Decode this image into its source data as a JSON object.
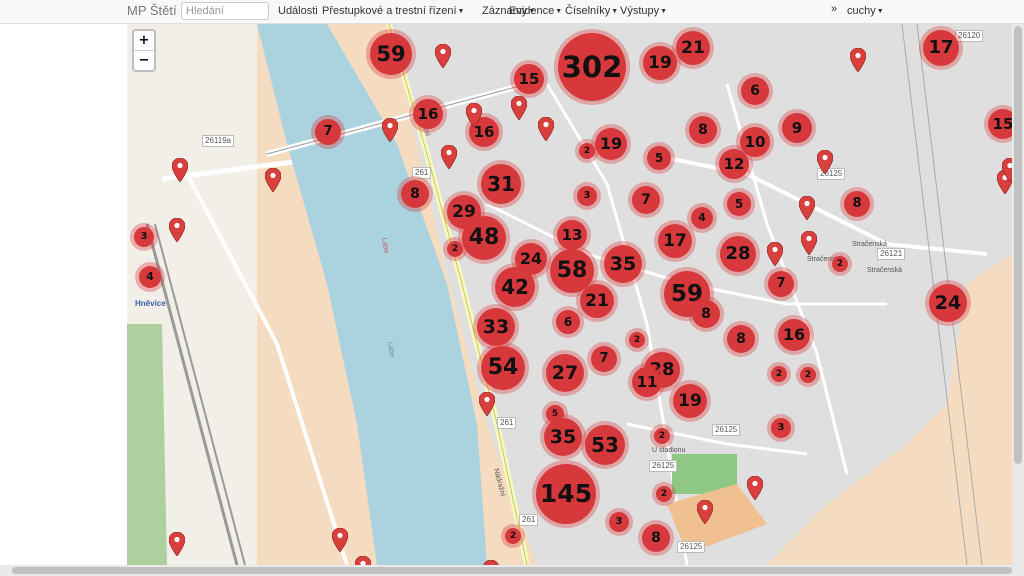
{
  "navbar": {
    "brand": "MP Štětí",
    "search_placeholder": "Hledání",
    "items": [
      {
        "label": "Události",
        "caret": false
      },
      {
        "label": "Přestupkové a trestní řízení",
        "caret": true
      },
      {
        "label": "Záznamy",
        "caret": true
      },
      {
        "label": "Evidence",
        "caret": true
      },
      {
        "label": "Číselníky",
        "caret": true
      },
      {
        "label": "Výstupy",
        "caret": true
      }
    ],
    "collapse_glyph": "»",
    "user": "cuchy"
  },
  "map": {
    "zoom_in": "+",
    "zoom_out": "−",
    "colors": {
      "cluster": "#d6383c",
      "pin": "#d9403d",
      "river": "#aad3df",
      "land": "#eee9e1",
      "urban": "#e0dfdf",
      "forest": "#add19e",
      "rail": "#999999"
    },
    "town_label": "Hněvice",
    "road_labels": [
      "261",
      "261",
      "261",
      "26119a",
      "26125",
      "26125",
      "26125",
      "26125",
      "26121",
      "26120"
    ],
    "street_labels": [
      "Stračenská",
      "Stračenská",
      "Stračenská",
      "U stadionu",
      "Nádražní",
      "Nádražní",
      "Labe",
      "Labe"
    ],
    "clusters": [
      "59",
      "302",
      "21",
      "19",
      "17",
      "15",
      "16",
      "16",
      "7",
      "15",
      "6",
      "8",
      "9",
      "10",
      "19",
      "5",
      "12",
      "31",
      "8",
      "2",
      "3",
      "7",
      "5",
      "8",
      "29",
      "48",
      "4",
      "17",
      "28",
      "13",
      "24",
      "58",
      "35",
      "2",
      "42",
      "21",
      "7",
      "2",
      "59",
      "8",
      "24",
      "33",
      "6",
      "8",
      "16",
      "2",
      "54",
      "27",
      "7",
      "2",
      "28",
      "11",
      "2",
      "19",
      "5",
      "3",
      "35",
      "53",
      "2",
      "145",
      "2",
      "3",
      "2",
      "8",
      "3",
      "4"
    ],
    "pin_count": 25
  }
}
